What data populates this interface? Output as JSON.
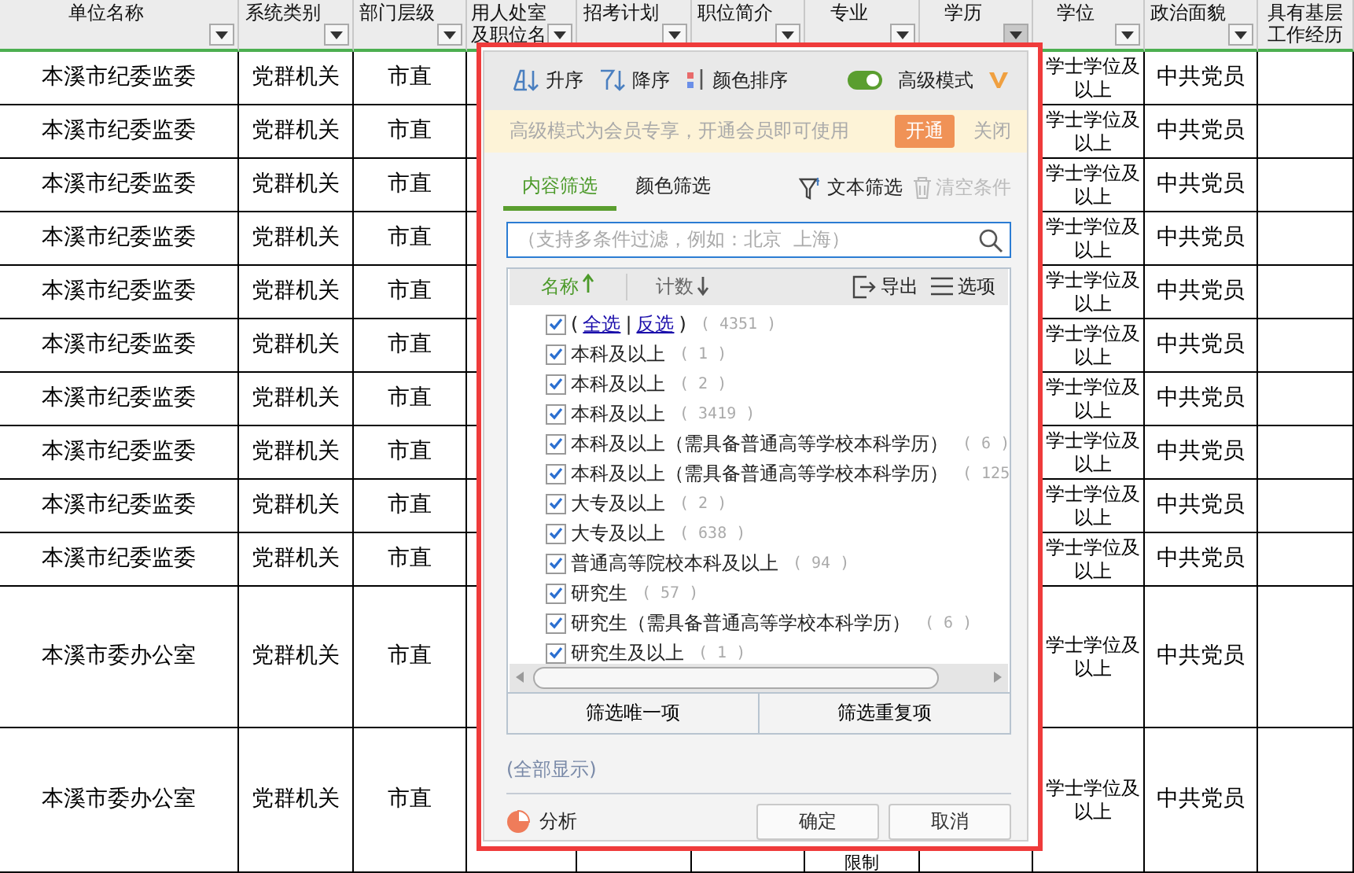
{
  "sheet": {
    "columns": [
      {
        "label": "单位名称",
        "filter": true
      },
      {
        "label": "系统类别",
        "filter": true
      },
      {
        "label": "部门层级",
        "filter": true
      },
      {
        "label": "用人处室及职位名",
        "filter": true
      },
      {
        "label": "招考计划",
        "filter": true
      },
      {
        "label": "职位简介",
        "filter": true
      },
      {
        "label": "专业",
        "filter": true
      },
      {
        "label": "学历",
        "filter": true,
        "selected": true
      },
      {
        "label": "学位",
        "filter": true
      },
      {
        "label": "政治面貌",
        "filter": true
      },
      {
        "label": "具有基层工作经历",
        "filter": false
      }
    ],
    "rows": [
      {
        "cells": [
          "本溪市纪委监委",
          "党群机关",
          "市直",
          "",
          "",
          "",
          "",
          "",
          "学士学位及以上",
          "中共党员",
          ""
        ]
      },
      {
        "cells": [
          "本溪市纪委监委",
          "党群机关",
          "市直",
          "",
          "",
          "",
          "",
          "",
          "学士学位及以上",
          "中共党员",
          ""
        ]
      },
      {
        "cells": [
          "本溪市纪委监委",
          "党群机关",
          "市直",
          "",
          "",
          "",
          "",
          "",
          "学士学位及以上",
          "中共党员",
          ""
        ]
      },
      {
        "cells": [
          "本溪市纪委监委",
          "党群机关",
          "市直",
          "",
          "",
          "",
          "",
          "",
          "学士学位及以上",
          "中共党员",
          ""
        ]
      },
      {
        "cells": [
          "本溪市纪委监委",
          "党群机关",
          "市直",
          "",
          "",
          "",
          "",
          "",
          "学士学位及以上",
          "中共党员",
          ""
        ]
      },
      {
        "cells": [
          "本溪市纪委监委",
          "党群机关",
          "市直",
          "",
          "",
          "",
          "",
          "",
          "学士学位及以上",
          "中共党员",
          ""
        ]
      },
      {
        "cells": [
          "本溪市纪委监委",
          "党群机关",
          "市直",
          "",
          "",
          "",
          "",
          "",
          "学士学位及以上",
          "中共党员",
          ""
        ]
      },
      {
        "cells": [
          "本溪市纪委监委",
          "党群机关",
          "市直",
          "",
          "",
          "",
          "",
          "",
          "学士学位及以上",
          "中共党员",
          ""
        ]
      },
      {
        "cells": [
          "本溪市纪委监委",
          "党群机关",
          "市直",
          "",
          "",
          "",
          "",
          "",
          "学士学位及以上",
          "中共党员",
          ""
        ]
      },
      {
        "cells": [
          "本溪市纪委监委",
          "党群机关",
          "市直",
          "",
          "",
          "",
          "",
          "",
          "学士学位及以上",
          "中共党员",
          ""
        ]
      },
      {
        "cells": [
          "本溪市委办公室",
          "党群机关",
          "市直",
          "",
          "",
          "",
          "",
          "",
          "学士学位及以上",
          "中共党员",
          ""
        ]
      },
      {
        "cells": [
          "本溪市委办公室",
          "党群机关",
          "市直",
          "",
          "",
          "",
          "限制",
          "",
          "学士学位及以上",
          "中共党员",
          ""
        ]
      }
    ]
  },
  "filter_popup": {
    "sort_buttons": [
      {
        "label": "升序",
        "kind": "asc"
      },
      {
        "label": "降序",
        "kind": "desc"
      },
      {
        "label": "颜色排序",
        "kind": "color"
      }
    ],
    "advanced_mode": {
      "label": "高级模式",
      "on": true
    },
    "banner": {
      "text": "高级模式为会员专享，开通会员即可使用",
      "action": "开通",
      "close": "关闭"
    },
    "tabs": [
      {
        "label": "内容筛选",
        "selected": true
      },
      {
        "label": "颜色筛选",
        "selected": false
      }
    ],
    "text_filter": "文本筛选",
    "clear": {
      "label": "清空条件",
      "disabled": true
    },
    "search": {
      "placeholder": "（支持多条件过滤，例如：北京  上海）"
    },
    "list_header": {
      "name": "名称",
      "count": "计数",
      "export": "导出",
      "options": "选项"
    },
    "items": [
      {
        "kind": "links",
        "parts": [
          {
            "text": "(",
            "link": false
          },
          {
            "text": "全选",
            "link": true
          },
          {
            "text": "|",
            "link": false
          },
          {
            "text": "反选",
            "link": true
          },
          {
            "text": ")",
            "link": false
          }
        ],
        "count": "( 4351 )",
        "checked": true
      },
      {
        "kind": "value",
        "label": "本科及以上",
        "count": "( 1 )",
        "checked": true
      },
      {
        "kind": "value",
        "label": "本科及以上",
        "count": "( 2 )",
        "checked": true
      },
      {
        "kind": "value",
        "label": "本科及以上",
        "count": "( 3419 )",
        "checked": true
      },
      {
        "kind": "value",
        "label": "本科及以上（需具备普通高等学校本科学历）",
        "count": "( 6 )",
        "checked": true
      },
      {
        "kind": "value",
        "label": "本科及以上（需具备普通高等学校本科学历）",
        "count": "( 125",
        "checked": true
      },
      {
        "kind": "value",
        "label": "大专及以上",
        "count": "( 2 )",
        "checked": true
      },
      {
        "kind": "value",
        "label": "大专及以上",
        "count": "( 638 )",
        "checked": true
      },
      {
        "kind": "value",
        "label": "普通高等院校本科及以上",
        "count": "( 94 )",
        "checked": true
      },
      {
        "kind": "value",
        "label": "研究生",
        "count": "( 57 )",
        "checked": true
      },
      {
        "kind": "value",
        "label": "研究生（需具备普通高等学校本科学历）",
        "count": "( 6 )",
        "checked": true
      },
      {
        "kind": "value",
        "label": "研究生及以上",
        "count": "( 1 )",
        "checked": true
      }
    ],
    "list_buttons": [
      "筛选唯一项",
      "筛选重复项"
    ],
    "show_all": "(全部显示)",
    "analysis": "分析",
    "buttons": [
      "确定",
      "取消"
    ]
  }
}
